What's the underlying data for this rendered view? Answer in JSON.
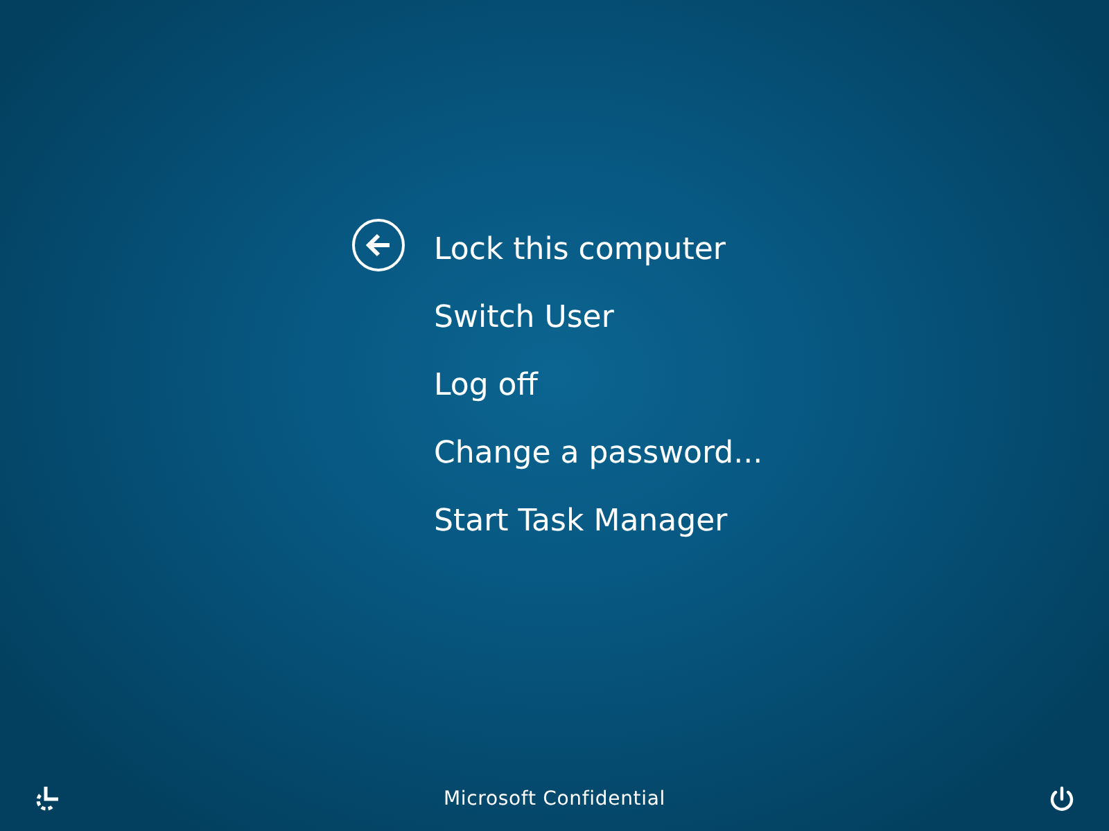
{
  "menu": {
    "items": [
      {
        "label": "Lock this computer"
      },
      {
        "label": "Switch User"
      },
      {
        "label": "Log off"
      },
      {
        "label": "Change a password..."
      },
      {
        "label": "Start Task Manager"
      }
    ]
  },
  "footer": {
    "text": "Microsoft Confidential"
  }
}
